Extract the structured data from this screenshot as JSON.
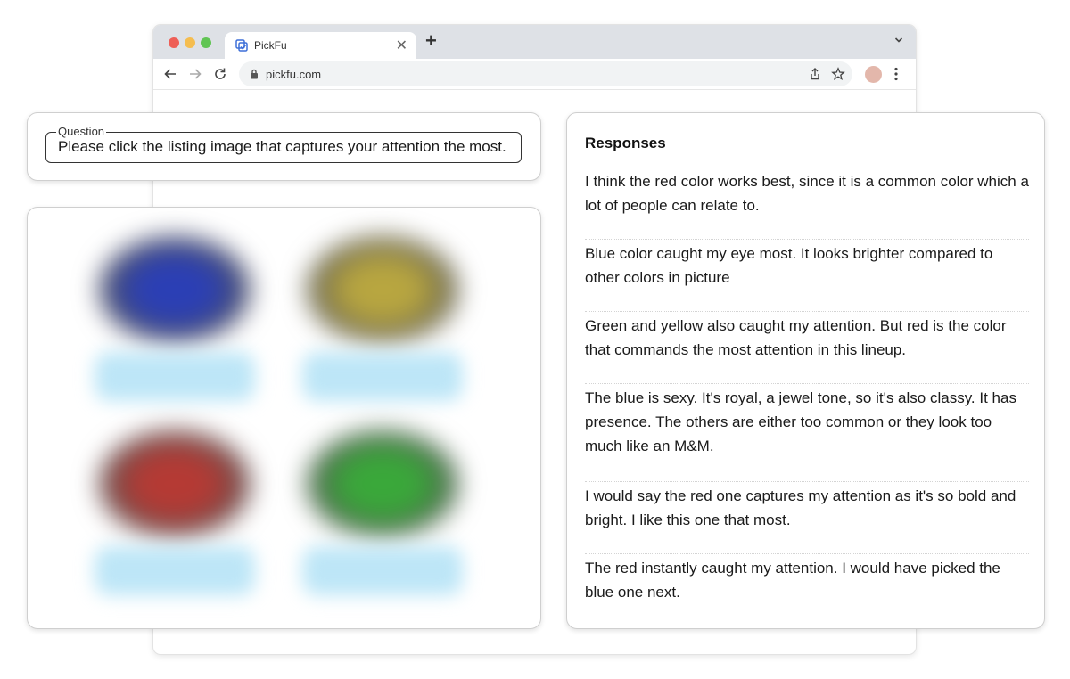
{
  "browser": {
    "tab_title": "PickFu",
    "url": "pickfu.com",
    "colors": {
      "close": "#ee5f57",
      "minimize": "#f5bd4f",
      "maximize": "#61c554",
      "profile": "#e3b7ab"
    }
  },
  "question": {
    "label": "Question",
    "text": "Please click the listing image that captures your attention the most."
  },
  "listing_images": [
    {
      "color_name": "blue",
      "color": "#2b3fb5"
    },
    {
      "color_name": "yellow",
      "color": "#b8a640"
    },
    {
      "color_name": "red",
      "color": "#b53a34"
    },
    {
      "color_name": "green",
      "color": "#3aa83a"
    }
  ],
  "responses": {
    "title": "Responses",
    "items": [
      "I think the red color works best, since it is a common color which a lot of people can relate to.",
      "Blue color caught my eye most. It looks brighter compared to other colors in picture",
      "Green and yellow also caught my attention. But red is the color that commands the most attention in this lineup.",
      "The blue is sexy. It's royal, a jewel tone, so it's also classy. It has presence. The others are either too common or they look too much like an M&M.",
      "I would say the red one captures my attention as it's so bold and bright. I like this one that most.",
      "The red instantly caught my attention. I would have picked the blue one next."
    ]
  }
}
